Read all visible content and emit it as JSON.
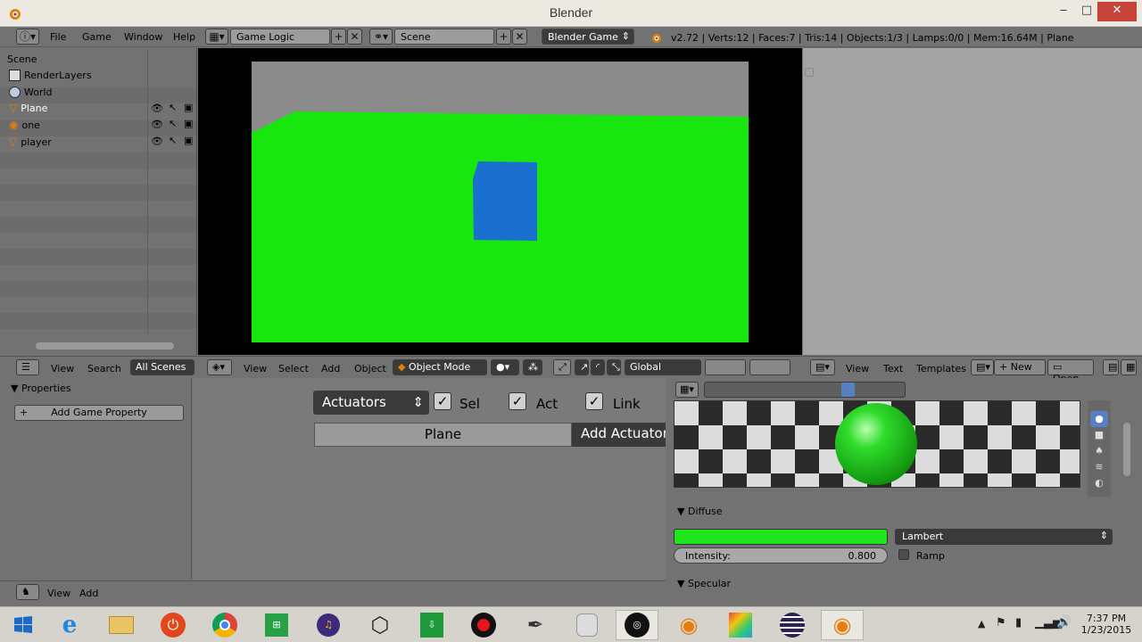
{
  "window": {
    "title": "Blender",
    "minimize": "‒",
    "maximize": "□",
    "close": "✕"
  },
  "info_header": {
    "menus": [
      "File",
      "Game",
      "Window",
      "Help"
    ],
    "screen_layout": "Game Logic",
    "scene": "Scene",
    "engine": "Blender Game",
    "stats": "v2.72 | Verts:12 | Faces:7 | Tris:14 | Objects:1/3 | Lamps:0/0 | Mem:16.64M | Plane"
  },
  "outliner": {
    "title": "Scene",
    "items": [
      {
        "label": "RenderLayers"
      },
      {
        "label": "World"
      },
      {
        "label": "Plane"
      },
      {
        "label": "one"
      },
      {
        "label": "player"
      }
    ]
  },
  "outliner_header": {
    "menus": [
      "View",
      "Search"
    ],
    "filter": "All Scenes"
  },
  "viewport_header": {
    "menus": [
      "View",
      "Select",
      "Add",
      "Object"
    ],
    "mode": "Object Mode",
    "orientation": "Global"
  },
  "text_header": {
    "menus": [
      "View",
      "Text",
      "Templates"
    ],
    "new_label": "New",
    "open_label": "Open"
  },
  "properties": {
    "title": "Properties",
    "add_property": "Add Game Property"
  },
  "logic": {
    "actuators_label": "Actuators",
    "sel_label": "Sel",
    "act_label": "Act",
    "link_label": "Link",
    "object_name": "Plane",
    "add_actuator": "Add Actuator"
  },
  "material": {
    "diffuse_title": "Diffuse",
    "shader": "Lambert",
    "intensity_label": "Intensity:",
    "intensity_value": "0.800",
    "ramp_label": "Ramp",
    "specular_title": "Specular",
    "diffuse_color": "#1ee51e"
  },
  "bottom_header": {
    "menus": [
      "View",
      "Add"
    ]
  },
  "clock": {
    "time": "7:37 PM",
    "date": "1/23/2015"
  },
  "colors": {
    "ground": "#18e60f",
    "cube": "#1a6fcf",
    "sky": "#8b8b8b"
  }
}
